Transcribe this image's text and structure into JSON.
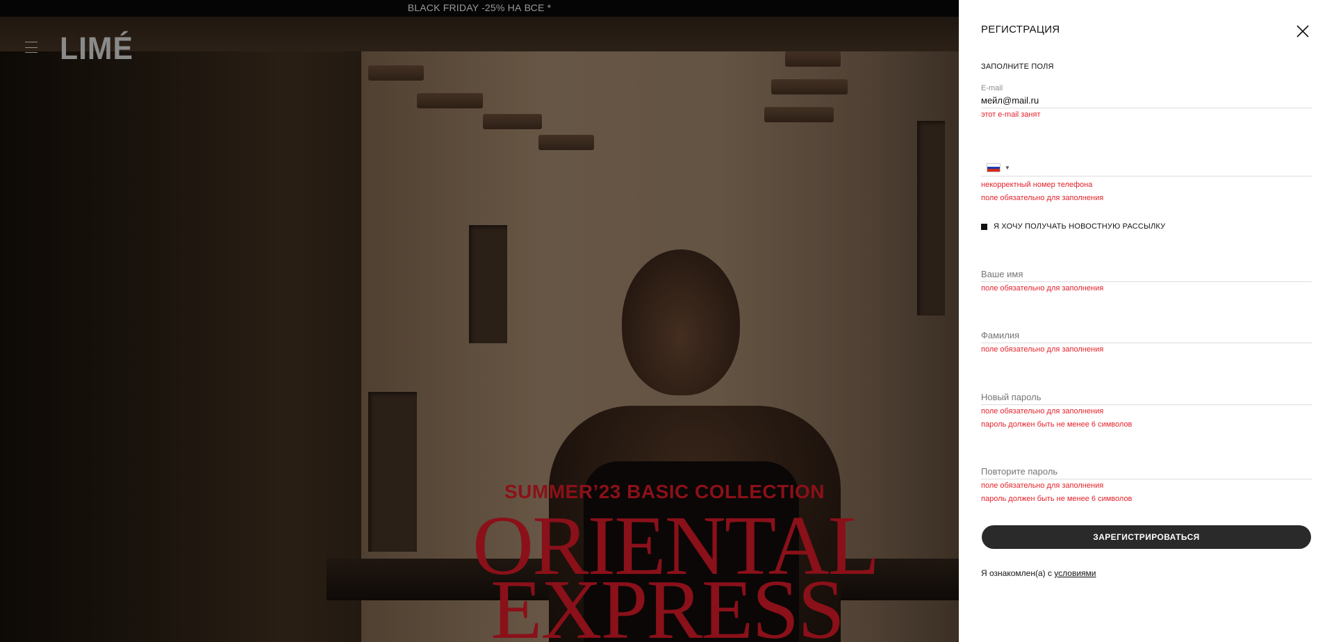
{
  "promo": {
    "text": "BLACK FRIDAY -25% НА ВСЕ *"
  },
  "header": {
    "logo": "LIMÉ"
  },
  "hero": {
    "collection": "SUMMER’23 BASIC COLLECTION",
    "title_line1": "ORIENTAL",
    "title_line2": "EXPRESS"
  },
  "registration": {
    "title": "РЕГИСТРАЦИЯ",
    "subtitle": "ЗАПОЛНИТЕ ПОЛЯ",
    "email": {
      "label": "E-mail",
      "value": "мейл@mail.ru",
      "error": "этот e-mail занят"
    },
    "phone": {
      "country": "RU",
      "value": "",
      "errors": [
        "некорректный номер телефона",
        "поле обязательно для заполнения"
      ]
    },
    "newsletter": {
      "label": "Я ХОЧУ ПОЛУЧАТЬ НОВОСТНУЮ РАССЫЛКУ",
      "checked": true
    },
    "first_name": {
      "placeholder": "Ваше имя",
      "error": "поле обязательно для заполнения"
    },
    "last_name": {
      "placeholder": "Фамилия",
      "error": "поле обязательно для заполнения"
    },
    "new_password": {
      "placeholder": "Новый пароль",
      "errors": [
        "поле обязательно для заполнения",
        "пароль должен быть не менее 6 символов"
      ]
    },
    "repeat_password": {
      "placeholder": "Повторите пароль",
      "errors": [
        "поле обязательно для заполнения",
        "пароль должен быть не менее 6 символов"
      ]
    },
    "submit_label": "ЗАРЕГИСТРИРОВАТЬСЯ",
    "terms_prefix": "Я ознакомлен(а) с ",
    "terms_link": "условиями"
  },
  "icons": {
    "close": "close-icon",
    "menu": "menu-icon",
    "flag": "russia-flag-icon",
    "dropdown": "chevron-down-icon"
  },
  "colors": {
    "error": "#e3222b",
    "accent_red": "#8a1019",
    "button": "#2a2a2a"
  }
}
